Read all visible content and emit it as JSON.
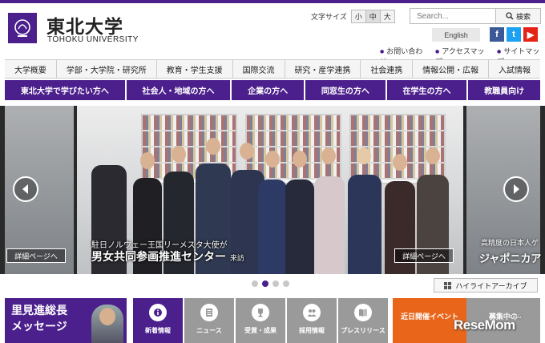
{
  "header": {
    "logo_jp": "東北大学",
    "logo_en": "TOHOKU UNIVERSITY",
    "font_size_label": "文字サイズ",
    "font_sizes": [
      "小",
      "中",
      "大"
    ],
    "font_size_selected": "中",
    "search_placeholder": "Search...",
    "search_button": "検索",
    "english_button": "English",
    "social": [
      "f",
      "t",
      "▶"
    ],
    "util_links": [
      "お問い合わせ",
      "アクセスマップ",
      "サイトマップ"
    ],
    "accent_color": "#4b1f8c"
  },
  "global_nav": [
    "大学概要",
    "学部・大学院・研究所",
    "教育・学生支援",
    "国際交流",
    "研究・産学連携",
    "社会連携",
    "情報公開・広報",
    "入試情報"
  ],
  "audience_nav": [
    "東北大学で学びたい方へ",
    "社会人・地域の方へ",
    "企業の方へ",
    "同窓生の方へ",
    "在学生の方へ",
    "教職員向け"
  ],
  "hero": {
    "caption_small": "駐日ノルウェー王国リーメスタ大使が",
    "caption_main": "男女共同参画推進センター",
    "caption_suffix": "来訪",
    "detail_button": "詳細ページへ",
    "right_caption_small": "高精度の日本人ゲ",
    "right_caption_main": "ジャポニカア",
    "slide_count": 4,
    "active_slide": 2,
    "archive_button": "ハイライトアーカイブ"
  },
  "president": {
    "line1": "里見進総長",
    "line2": "メッセージ"
  },
  "news_tabs": [
    {
      "label": "新着情報",
      "icon": "info-icon",
      "active": true
    },
    {
      "label": "ニュース",
      "icon": "document-icon",
      "active": false
    },
    {
      "label": "受賞・成果",
      "icon": "trophy-icon",
      "active": false
    },
    {
      "label": "採用情報",
      "icon": "people-icon",
      "active": false
    },
    {
      "label": "プレスリリース",
      "icon": "book-icon",
      "active": false
    }
  ],
  "events": {
    "upcoming": "近日開催イベント",
    "second": "募集中の"
  },
  "watermark": "ReseMom",
  "watermark_sub": "リセマム"
}
